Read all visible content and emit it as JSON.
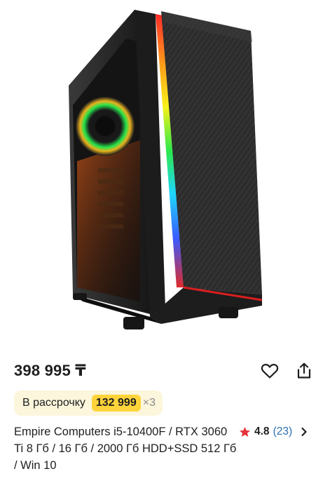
{
  "product": {
    "price": "398 995 ₸",
    "installment": {
      "label": "В рассрочку",
      "amount": "132 999",
      "multiplier": "×3"
    },
    "title": "Empire Computers i5-10400F / RTX 3060 Ti 8 Гб / 16 Гб / 2000 Гб HDD+SSD 512 Гб / Win 10",
    "rating": {
      "score": "4.8",
      "count": "(23)",
      "star_color": "#e5333d"
    },
    "image": {
      "subject": "pc-tower-case-rgb"
    }
  },
  "icons": {
    "favorite": "heart-icon",
    "share": "share-icon",
    "rating": "star-icon",
    "more": "chevron-right-icon"
  },
  "colors": {
    "installment_bg": "#fbf6dc",
    "installment_amount_bg": "#ffd43a",
    "rating_count": "#2a6fb0"
  }
}
